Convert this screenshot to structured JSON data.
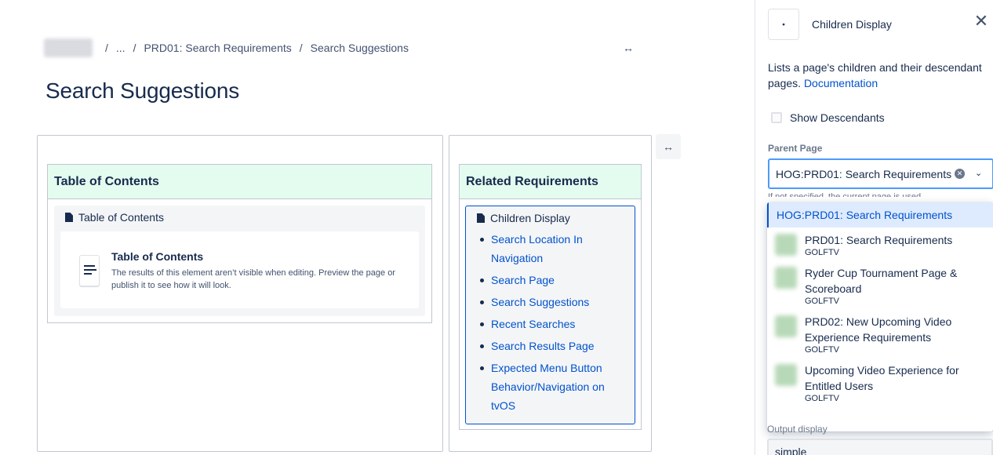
{
  "breadcrumb": {
    "ellipsis": "...",
    "parent": "PRD01: Search Requirements",
    "current": "Search Suggestions",
    "separator": "/"
  },
  "page": {
    "title": "Search Suggestions",
    "width_toggle": "↔"
  },
  "left_panel": {
    "heading": "Table of Contents",
    "macro_title": "Table of Contents",
    "card_title": "Table of Contents",
    "card_desc": "The results of this element aren’t visible when editing. Preview the page or publish it to see how it will look."
  },
  "right_panel": {
    "heading": "Related Requirements",
    "macro_title": "Children Display",
    "children": [
      "Search Location In Navigation",
      "Search Page",
      "Search Suggestions",
      "Recent Searches",
      "Search Results Page",
      "Expected Menu Button Behavior/Navigation on tvOS"
    ]
  },
  "sidebar": {
    "title": "Children Display",
    "close": "✕",
    "description": "Lists a page's children and their descendant pages.",
    "doc_link": "Documentation",
    "show_descendants": "Show Descendants",
    "parent_label": "Parent Page",
    "parent_value": "HOG:PRD01: Search Requirements",
    "hidden_help": "If not specified, the current page is used",
    "bottom_label": "Output display",
    "bottom_value": "simple"
  },
  "dropdown": {
    "selected": "HOG:PRD01: Search Requirements",
    "options": [
      {
        "title": "PRD01: Search Requirements",
        "space": "GOLFTV"
      },
      {
        "title": "Ryder Cup Tournament Page & Scoreboard",
        "space": "GOLFTV"
      },
      {
        "title": "PRD02: New Upcoming Video Experience Requirements",
        "space": "GOLFTV"
      },
      {
        "title": "Upcoming Video Experience for Entitled Users",
        "space": "GOLFTV"
      }
    ]
  },
  "colors": {
    "link": "#0052cc",
    "panel_header": "#e3fcef",
    "focus": "#4c9aff",
    "selected_bg": "#deebff"
  }
}
